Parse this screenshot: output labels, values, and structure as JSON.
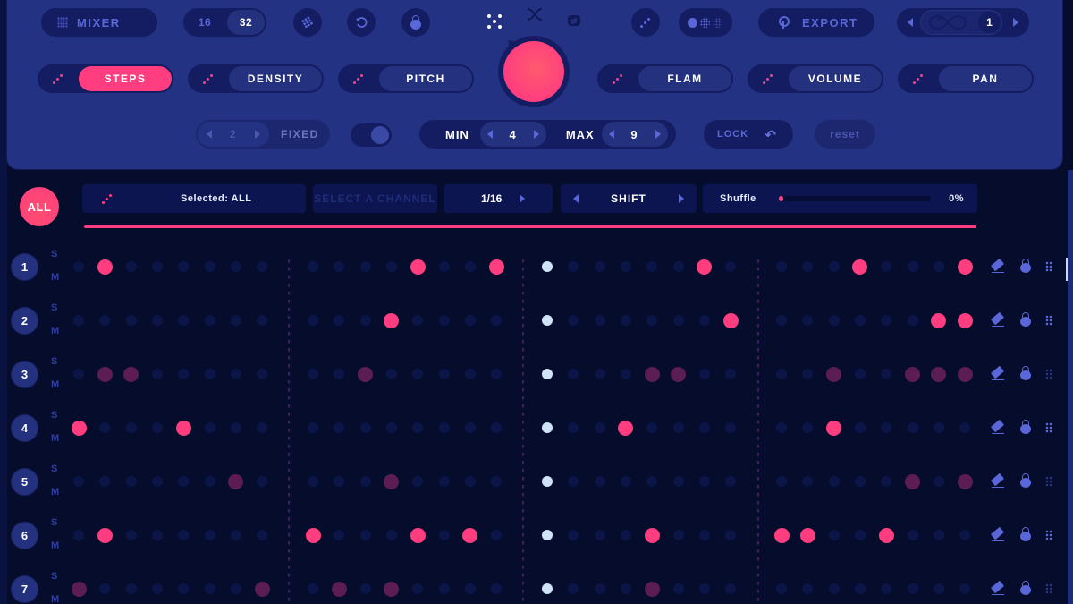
{
  "toolbar": {
    "mixer_label": "MIXER",
    "resolution_options": [
      "16",
      "32"
    ],
    "resolution_selected": "32",
    "export_label": "EXPORT",
    "loop_count": "1",
    "param_tabs": [
      {
        "label": "STEPS",
        "active": true
      },
      {
        "label": "DENSITY",
        "active": false
      },
      {
        "label": "PITCH",
        "active": false
      },
      {
        "label": "FLAM",
        "active": false
      },
      {
        "label": "VOLUME",
        "active": false
      },
      {
        "label": "PAN",
        "active": false
      }
    ],
    "fixed": {
      "value": "2",
      "label": "FIXED"
    },
    "min": {
      "label": "MIN",
      "value": "4"
    },
    "max": {
      "label": "MAX",
      "value": "9"
    },
    "lock_label": "LOCK",
    "reset_label": "reset"
  },
  "icons": {
    "mixer": "mixer-icon",
    "grid": "grid-icon",
    "undo_circle": "rotate-icon",
    "lock": "lock-icon",
    "dice": "dice-icon",
    "shuffle": "shuffle-icon",
    "swap": "swap-icon",
    "diagonal": "diagonal-dots-icon",
    "density_view": "density-view-icon",
    "export": "export-icon",
    "loop": "infinity-loop-icon"
  },
  "channel_bar": {
    "all_label": "ALL",
    "selected_text": "Selected: ALL",
    "channel_placeholder": "SELECT A CHANNEL",
    "rate": "1/16",
    "shift_label": "SHIFT",
    "shuffle_label": "Shuffle",
    "shuffle_value": "0%",
    "shuffle_percent": 0,
    "progress_percent": 100
  },
  "colors": {
    "accent": "#ff3d7f",
    "ghost": "#5c1d55",
    "playhead": "#cfe3f6",
    "off": "#0c1548",
    "panel": "#233282",
    "background": "#060c2c"
  },
  "grid": {
    "steps": 32,
    "playhead_step": 17,
    "tracks": [
      {
        "number": "1",
        "solo": "S",
        "mute": "M",
        "on": [
          2,
          13,
          16,
          23,
          28,
          32
        ],
        "ghost": [],
        "grip_bright": true
      },
      {
        "number": "2",
        "solo": "S",
        "mute": "M",
        "on": [
          12,
          24,
          31,
          32
        ],
        "ghost": [],
        "grip_bright": true
      },
      {
        "number": "3",
        "solo": "S",
        "mute": "M",
        "on": [],
        "ghost": [
          2,
          3,
          11,
          21,
          22,
          27,
          30,
          31,
          32
        ],
        "grip_bright": false
      },
      {
        "number": "4",
        "solo": "S",
        "mute": "M",
        "on": [
          1,
          5,
          20,
          27
        ],
        "ghost": [],
        "grip_bright": true
      },
      {
        "number": "5",
        "solo": "S",
        "mute": "M",
        "on": [],
        "ghost": [
          7,
          12,
          30,
          32
        ],
        "grip_bright": false
      },
      {
        "number": "6",
        "solo": "S",
        "mute": "M",
        "on": [
          2,
          9,
          13,
          15,
          21,
          25,
          26,
          29
        ],
        "ghost": [],
        "grip_bright": true
      },
      {
        "number": "7",
        "solo": "S",
        "mute": "M",
        "on": [],
        "ghost": [
          1,
          8,
          10,
          12,
          21
        ],
        "grip_bright": false
      }
    ]
  }
}
